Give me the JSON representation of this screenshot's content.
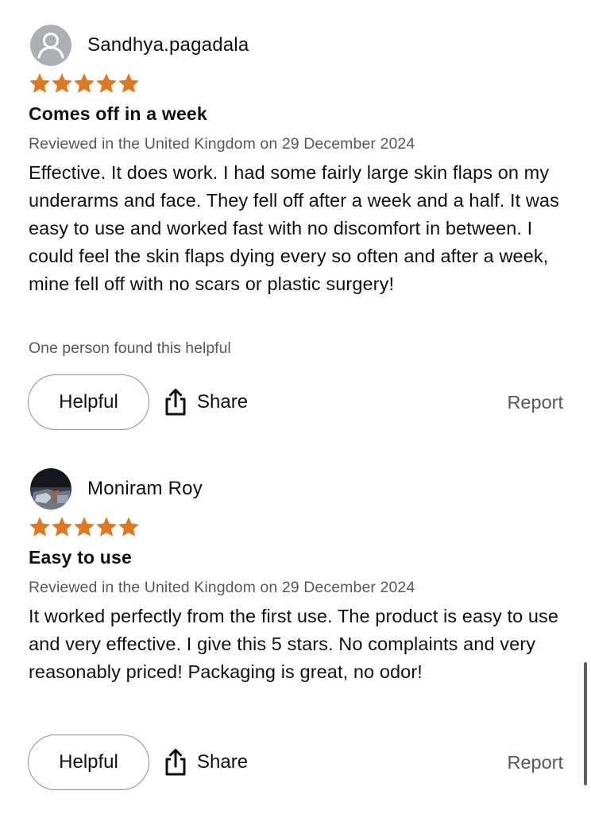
{
  "reviews": [
    {
      "reviewer_name": "Sandhya.pagadala",
      "avatar_icon": "default-user-icon",
      "rating": 5,
      "max_rating": 5,
      "title": "Comes off in a week",
      "meta": "Reviewed in the United Kingdom on 29 December 2024",
      "body": "Effective. It does work. I had some fairly large skin flaps on my underarms and face. They fell off after a week and a half. It was easy to use and worked fast with no discomfort in between. I could feel the skin flaps dying every so often and after a week, mine fell off with no scars or plastic surgery!",
      "helpful_count_text": "One person found this helpful",
      "helpful_label": "Helpful",
      "share_label": "Share",
      "report_label": "Report"
    },
    {
      "reviewer_name": "Moniram Roy",
      "avatar_icon": "user-photo",
      "rating": 5,
      "max_rating": 5,
      "title": "Easy to use",
      "meta": "Reviewed in the United Kingdom on 29 December 2024",
      "body": "It worked perfectly from the first use. The product is easy to use and very effective. I give this 5 stars. No complaints and very reasonably priced! Packaging is great, no odor!",
      "helpful_label": "Helpful",
      "share_label": "Share",
      "report_label": "Report"
    }
  ],
  "colors": {
    "star": "#de7921",
    "text": "#0f1111",
    "secondary_text": "#565959",
    "button_border": "#8d9096"
  },
  "icons": {
    "share": "share-icon",
    "star": "star-icon"
  }
}
